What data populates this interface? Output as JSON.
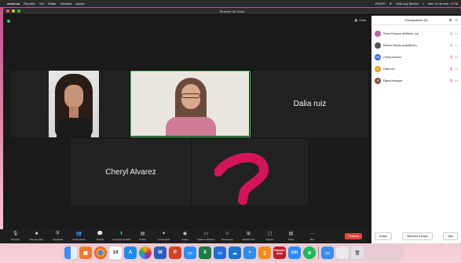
{
  "menubar": {
    "app_name": "zoom.us",
    "menus": [
      "Reunión",
      "Ver",
      "Editar",
      "Ventana",
      "Ayuda"
    ],
    "right": {
      "tray": "ROOFI",
      "status": "Hola soy Mecha",
      "clock": "Mar 14 de mar. 17:06"
    }
  },
  "window": {
    "title": "Reunión de Zoom",
    "view_label": "Vista"
  },
  "tiles": [
    {
      "name": "",
      "kind": "video-woman-dark-hair"
    },
    {
      "name": "",
      "kind": "video-woman-glasses",
      "active_speaker": true
    },
    {
      "name": "Dalia ruiz",
      "kind": "name"
    },
    {
      "name": "Cheryl Alvarez",
      "kind": "name"
    },
    {
      "name": "",
      "kind": "logo-pink"
    }
  ],
  "participants_panel": {
    "title": "Participantes (5)",
    "people": [
      {
        "name": "Sonia Dinarsa (Anfitrión, yo)",
        "initials": "",
        "color": "#9b59b6",
        "mic": "on",
        "cam": "on"
      },
      {
        "name": "Ramon Davila (coanfitrión)",
        "initials": "",
        "color": "#444444",
        "mic": "on",
        "cam": "on"
      },
      {
        "name": "Cheryl Alvarez",
        "initials": "CA",
        "color": "#2f6bd8",
        "mic": "off",
        "cam": "off"
      },
      {
        "name": "Dalia ruiz",
        "initials": "D",
        "color": "#e6a21a",
        "mic": "off",
        "cam": "off"
      },
      {
        "name": "Diana Aranguiz",
        "initials": "D",
        "color": "#8a4b3a",
        "mic": "off",
        "cam": "off"
      }
    ],
    "footer": {
      "invite": "Invitar",
      "mute_all": "Silenciar a todos",
      "more": "Más"
    }
  },
  "toolbar": {
    "items": [
      {
        "label": "Silenciar",
        "icon": "mic-icon"
      },
      {
        "label": "Detener video",
        "icon": "video-icon"
      },
      {
        "label": "Seguridad",
        "icon": "shield-icon"
      },
      {
        "label": "Participantes",
        "icon": "participants-icon"
      },
      {
        "label": "Chatear",
        "icon": "chat-icon"
      },
      {
        "label": "Compartir pantalla",
        "icon": "share-screen-icon"
      },
      {
        "label": "Grabar",
        "icon": "record-icon"
      },
      {
        "label": "Al Compartir",
        "icon": "annotate-icon"
      },
      {
        "label": "Grabar",
        "icon": "record-circle-icon"
      },
      {
        "label": "Mostrar subtítulos",
        "icon": "captions-icon"
      },
      {
        "label": "Reacciones",
        "icon": "reactions-icon"
      },
      {
        "label": "Aplicaciones",
        "icon": "apps-icon"
      },
      {
        "label": "Pizarras",
        "icon": "whiteboard-icon"
      },
      {
        "label": "Notas",
        "icon": "notes-icon"
      },
      {
        "label": "Más",
        "icon": "more-icon"
      }
    ],
    "end_label": "Finalizar"
  },
  "dock": {
    "apps": [
      "finder-icon",
      "launchpad-icon",
      "chrome-icon",
      "calendar-icon",
      "appstore-icon",
      "photos-icon",
      "word-icon",
      "powerpoint-icon",
      "zoom-icon",
      "excel-icon",
      "keynote-icon",
      "onedrive-icon",
      "teams-icon",
      "books-icon",
      "kobo-icon",
      "zoom-app-icon",
      "spotify-icon",
      "preview-icon",
      "trash-icon"
    ],
    "kobo_label": "Rakuten kobo",
    "calendar_day": "14"
  }
}
